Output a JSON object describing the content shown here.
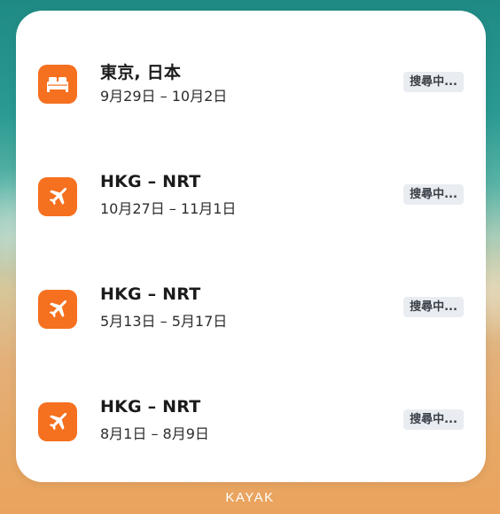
{
  "trips": [
    {
      "icon": "bed-icon",
      "title": "東京, 日本",
      "dates": "9月29日 – 10月2日",
      "status": "搜尋中..."
    },
    {
      "icon": "plane-icon",
      "title": "HKG – NRT",
      "dates": "10月27日 – 11月1日",
      "status": "搜尋中..."
    },
    {
      "icon": "plane-icon",
      "title": "HKG – NRT",
      "dates": "5月13日 – 5月17日",
      "status": "搜尋中..."
    },
    {
      "icon": "plane-icon",
      "title": "HKG – NRT",
      "dates": "8月1日 – 8月9日",
      "status": "搜尋中..."
    }
  ],
  "brand": "KAYAK",
  "colors": {
    "accent": "#f5701f",
    "badge_bg": "#e9ecf0",
    "card_bg": "#ffffff"
  }
}
